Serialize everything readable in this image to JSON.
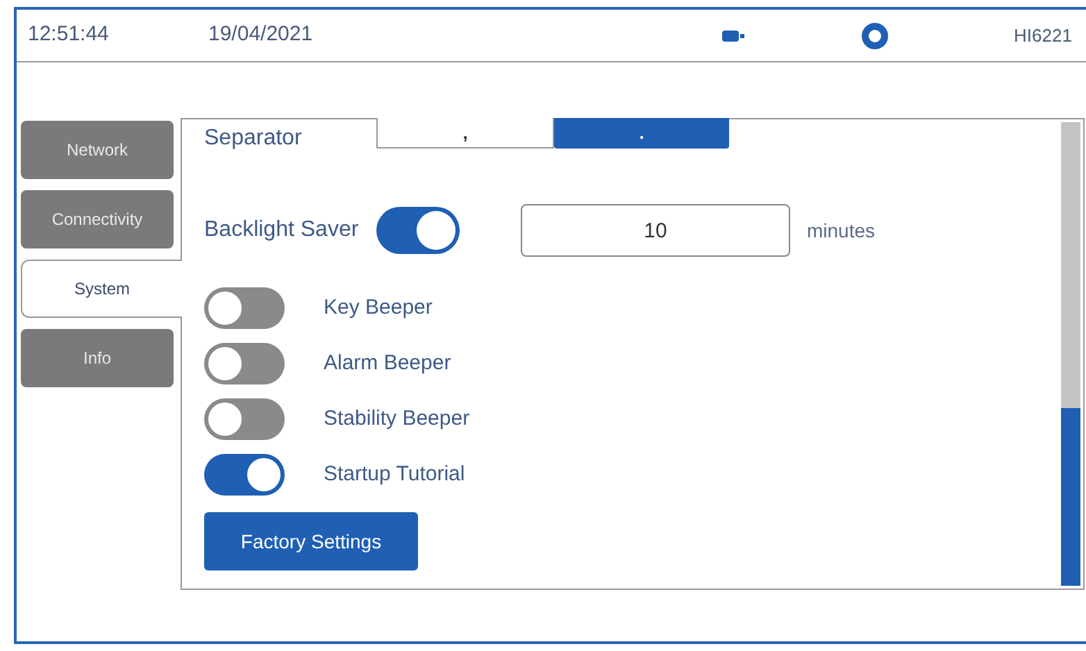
{
  "status_bar": {
    "time": "12:51:44",
    "date": "19/04/2021",
    "model": "HI6221"
  },
  "tabs": [
    {
      "label": "Network",
      "selected": false
    },
    {
      "label": "Connectivity",
      "selected": false
    },
    {
      "label": "System",
      "selected": true
    },
    {
      "label": "Info",
      "selected": false
    }
  ],
  "separator": {
    "label": "Separator",
    "options": [
      {
        "label": ",",
        "selected": false
      },
      {
        "label": ".",
        "selected": true
      }
    ]
  },
  "backlight": {
    "label": "Backlight Saver",
    "on": true,
    "value": "10",
    "unit": "minutes"
  },
  "settings": [
    {
      "label": "Key Beeper",
      "on": false
    },
    {
      "label": "Alarm Beeper",
      "on": false
    },
    {
      "label": "Stability Beeper",
      "on": false
    },
    {
      "label": "Startup Tutorial",
      "on": true
    }
  ],
  "buttons": [
    "Factory Settings"
  ]
}
